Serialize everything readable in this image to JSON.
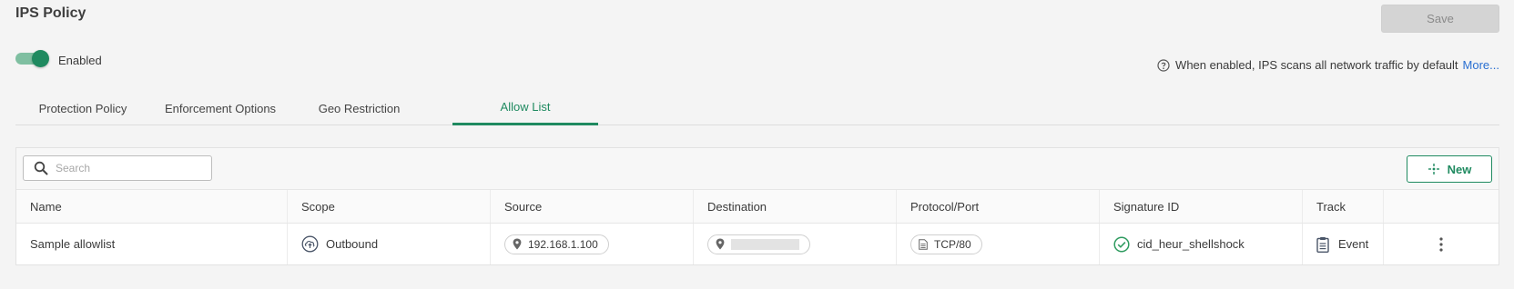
{
  "page": {
    "title": "IPS Policy"
  },
  "header": {
    "save_label": "Save"
  },
  "toggle": {
    "label": "Enabled",
    "state": "on"
  },
  "info": {
    "text": "When enabled, IPS scans all network traffic by default",
    "link": "More..."
  },
  "tabs": [
    {
      "label": "Protection Policy"
    },
    {
      "label": "Enforcement Options"
    },
    {
      "label": "Geo Restriction"
    },
    {
      "label": "Allow List",
      "active": true
    }
  ],
  "toolbar": {
    "search_placeholder": "Search",
    "search_value": "",
    "new_label": "New"
  },
  "table": {
    "columns": [
      "Name",
      "Scope",
      "Source",
      "Destination",
      "Protocol/Port",
      "Signature ID",
      "Track"
    ],
    "rows": [
      {
        "name": "Sample allowlist",
        "scope": "Outbound",
        "source": "192.168.1.100",
        "destination": "",
        "protocol_port": "TCP/80",
        "signature_id": "cid_heur_shellshock",
        "track": "Event"
      }
    ]
  },
  "colors": {
    "accent": "#1f8a60",
    "link": "#2a6fd1",
    "toggle_track": "#7fbfa1",
    "disabled_bg": "#d4d4d4"
  },
  "icons": {
    "toggle": "toggle-switch-on",
    "info": "help-circle-icon",
    "search": "search-icon",
    "new": "sparkle-plus-icon",
    "scope": "cloud-upload-icon",
    "location": "map-pin-icon",
    "protocol": "document-icon",
    "signature_ok": "check-circle-icon",
    "track": "clipboard-icon",
    "row_menu": "kebab-menu-icon"
  }
}
